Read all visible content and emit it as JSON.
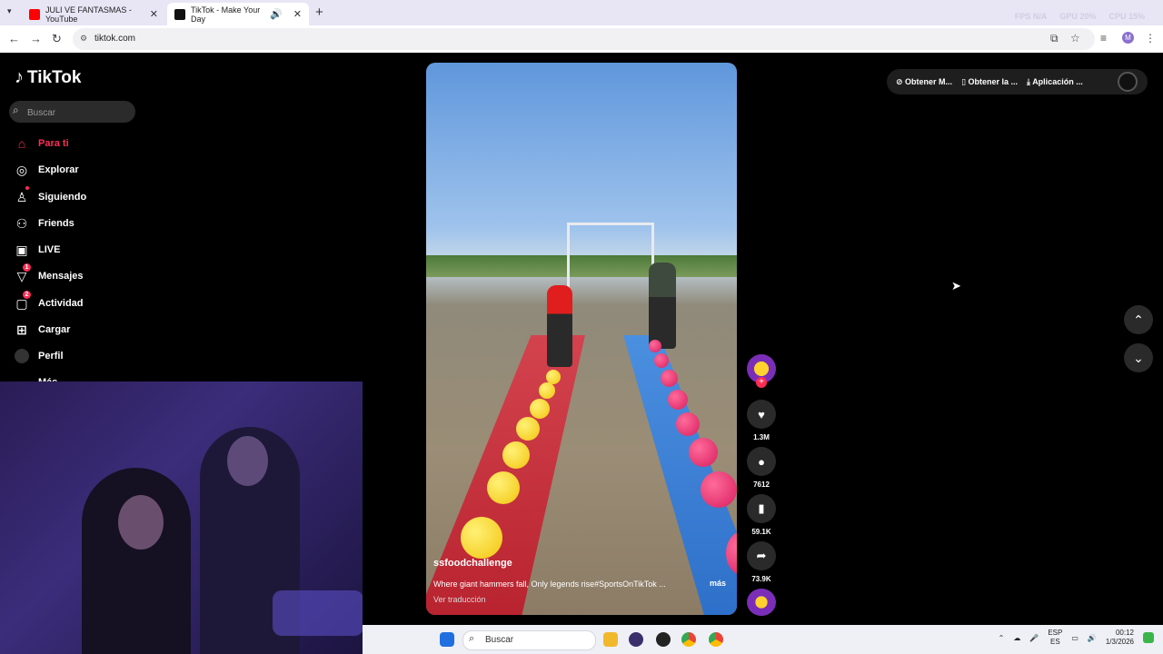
{
  "browser": {
    "tabs": [
      {
        "title": "JULI VE FANTASMAS - YouTube",
        "icon": "youtube-icon"
      },
      {
        "title": "TikTok - Make Your Day",
        "icon": "tiktok-icon"
      }
    ],
    "url": "tiktok.com",
    "profile_initial": "M",
    "overlay": {
      "fps_label": "FPS",
      "fps_value": "N/A",
      "gpu_label": "GPU",
      "gpu_value": "20%",
      "cpu_label": "CPU",
      "cpu_value": "15%"
    }
  },
  "tiktok": {
    "logo_text": "TikTok",
    "search_placeholder": "Buscar",
    "nav": [
      {
        "label": "Para ti",
        "icon": "home-icon",
        "active": true
      },
      {
        "label": "Explorar",
        "icon": "compass-icon"
      },
      {
        "label": "Siguiendo",
        "icon": "following-icon"
      },
      {
        "label": "Friends",
        "icon": "friends-icon"
      },
      {
        "label": "LIVE",
        "icon": "live-icon"
      },
      {
        "label": "Mensajes",
        "icon": "messages-icon",
        "badge": "1"
      },
      {
        "label": "Actividad",
        "icon": "activity-icon",
        "badge": "2"
      },
      {
        "label": "Cargar",
        "icon": "upload-icon"
      },
      {
        "label": "Perfil",
        "icon": "profile-avatar"
      },
      {
        "label": "Más",
        "icon": "more-icon"
      }
    ],
    "top_right": {
      "coins": "Obtener M...",
      "app": "Obtener la ...",
      "desktop": "Aplicación ..."
    },
    "video": {
      "username": "ssfoodchallenge",
      "description": "Where giant hammers fall, Only legends rise#SportsOnTikTok ...",
      "more": "más",
      "translate": "Ver traducción"
    },
    "actions": {
      "likes": "1.3M",
      "comments": "7612",
      "saves": "59.1K",
      "shares": "73.9K"
    }
  },
  "taskbar": {
    "search": "Buscar",
    "lang_top": "ESP",
    "lang_bottom": "ES",
    "time": "00:12",
    "date": "1/3/2026"
  }
}
